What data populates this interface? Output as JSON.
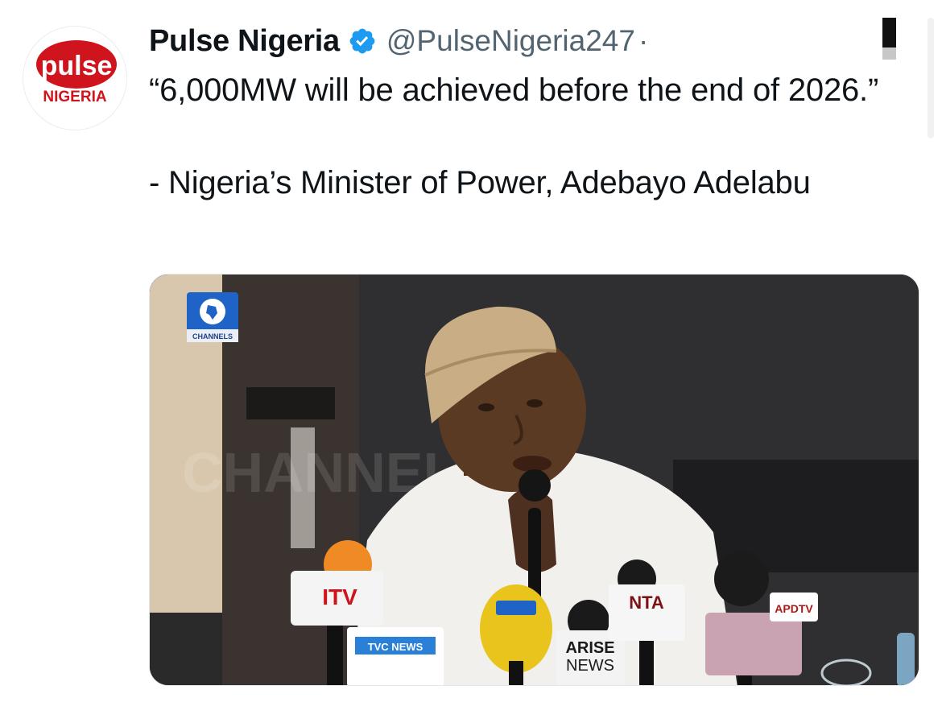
{
  "tweet": {
    "avatar": {
      "logo_text": "pulse",
      "logo_subtext": "NIGERIA",
      "brand_color": "#d0141d"
    },
    "display_name": "Pulse Nigeria",
    "verified_color": "#1d9bf0",
    "handle": "@PulseNigeria247",
    "separator": "·",
    "text_lines": [
      "“6,000MW will be achieved before the end of 2026.”",
      "- Nigeria’s Minister of Power, Adebayo Adelabu"
    ]
  },
  "media": {
    "channel_logo_text": "CHANNELS",
    "watermark_text": "CHANNELS",
    "microphone_labels": {
      "itv": "ITV",
      "tvc": "TVC NEWS",
      "nta": "NTA",
      "arise_line1": "ARISE",
      "arise_line2": "NEWS",
      "apd": "APDTV"
    },
    "colors": {
      "background_dark": "#2b2b2b",
      "agbada_white": "#f2f0ec",
      "cap_tan": "#c9ad84",
      "skin": "#5b3a24",
      "channels_blue": "#1f63c7"
    }
  }
}
